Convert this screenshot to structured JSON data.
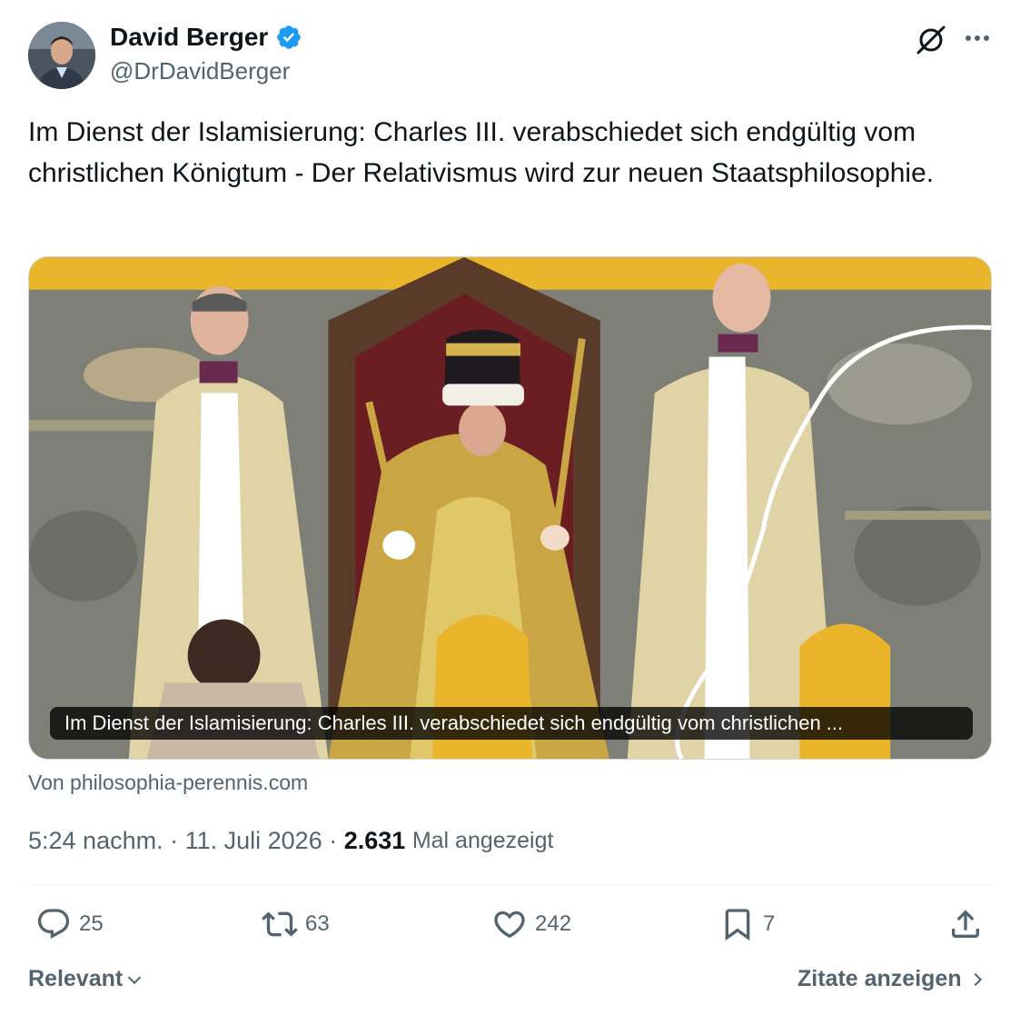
{
  "author": {
    "display_name": "David Berger",
    "handle": "@DrDavidBerger",
    "verified": true
  },
  "tweet": {
    "text": "Im Dienst der Islamisierung: Charles III. verabschiedet sich endgültig vom christlichen Königtum - Der Relativismus wird zur neuen Staatsphilosophie."
  },
  "media": {
    "caption": "Im Dienst der Islamisierung: Charles III. verabschiedet sich endgültig vom christlichen ...",
    "source": "Von philosophia-perennis.com"
  },
  "meta": {
    "time": "5:24 nachm.",
    "separator": " · ",
    "date": "11. Juli 2026",
    "views_count": "2.631",
    "views_label": "Mal angezeigt"
  },
  "actions": {
    "replies": "25",
    "reposts": "63",
    "likes": "242",
    "bookmarks": "7"
  },
  "footer": {
    "sort_label": "Relevant",
    "quotes_label": "Zitate anzeigen"
  },
  "colors": {
    "text_primary": "#0f1419",
    "text_secondary": "#536471",
    "verified_blue": "#1d9bf0",
    "divider": "#eff3f4"
  },
  "icons": {
    "verified": "verified-badge-icon",
    "grok": "grok-icon",
    "more": "more-icon",
    "reply": "reply-icon",
    "repost": "repost-icon",
    "like": "heart-icon",
    "bookmark": "bookmark-icon",
    "share": "share-icon"
  }
}
